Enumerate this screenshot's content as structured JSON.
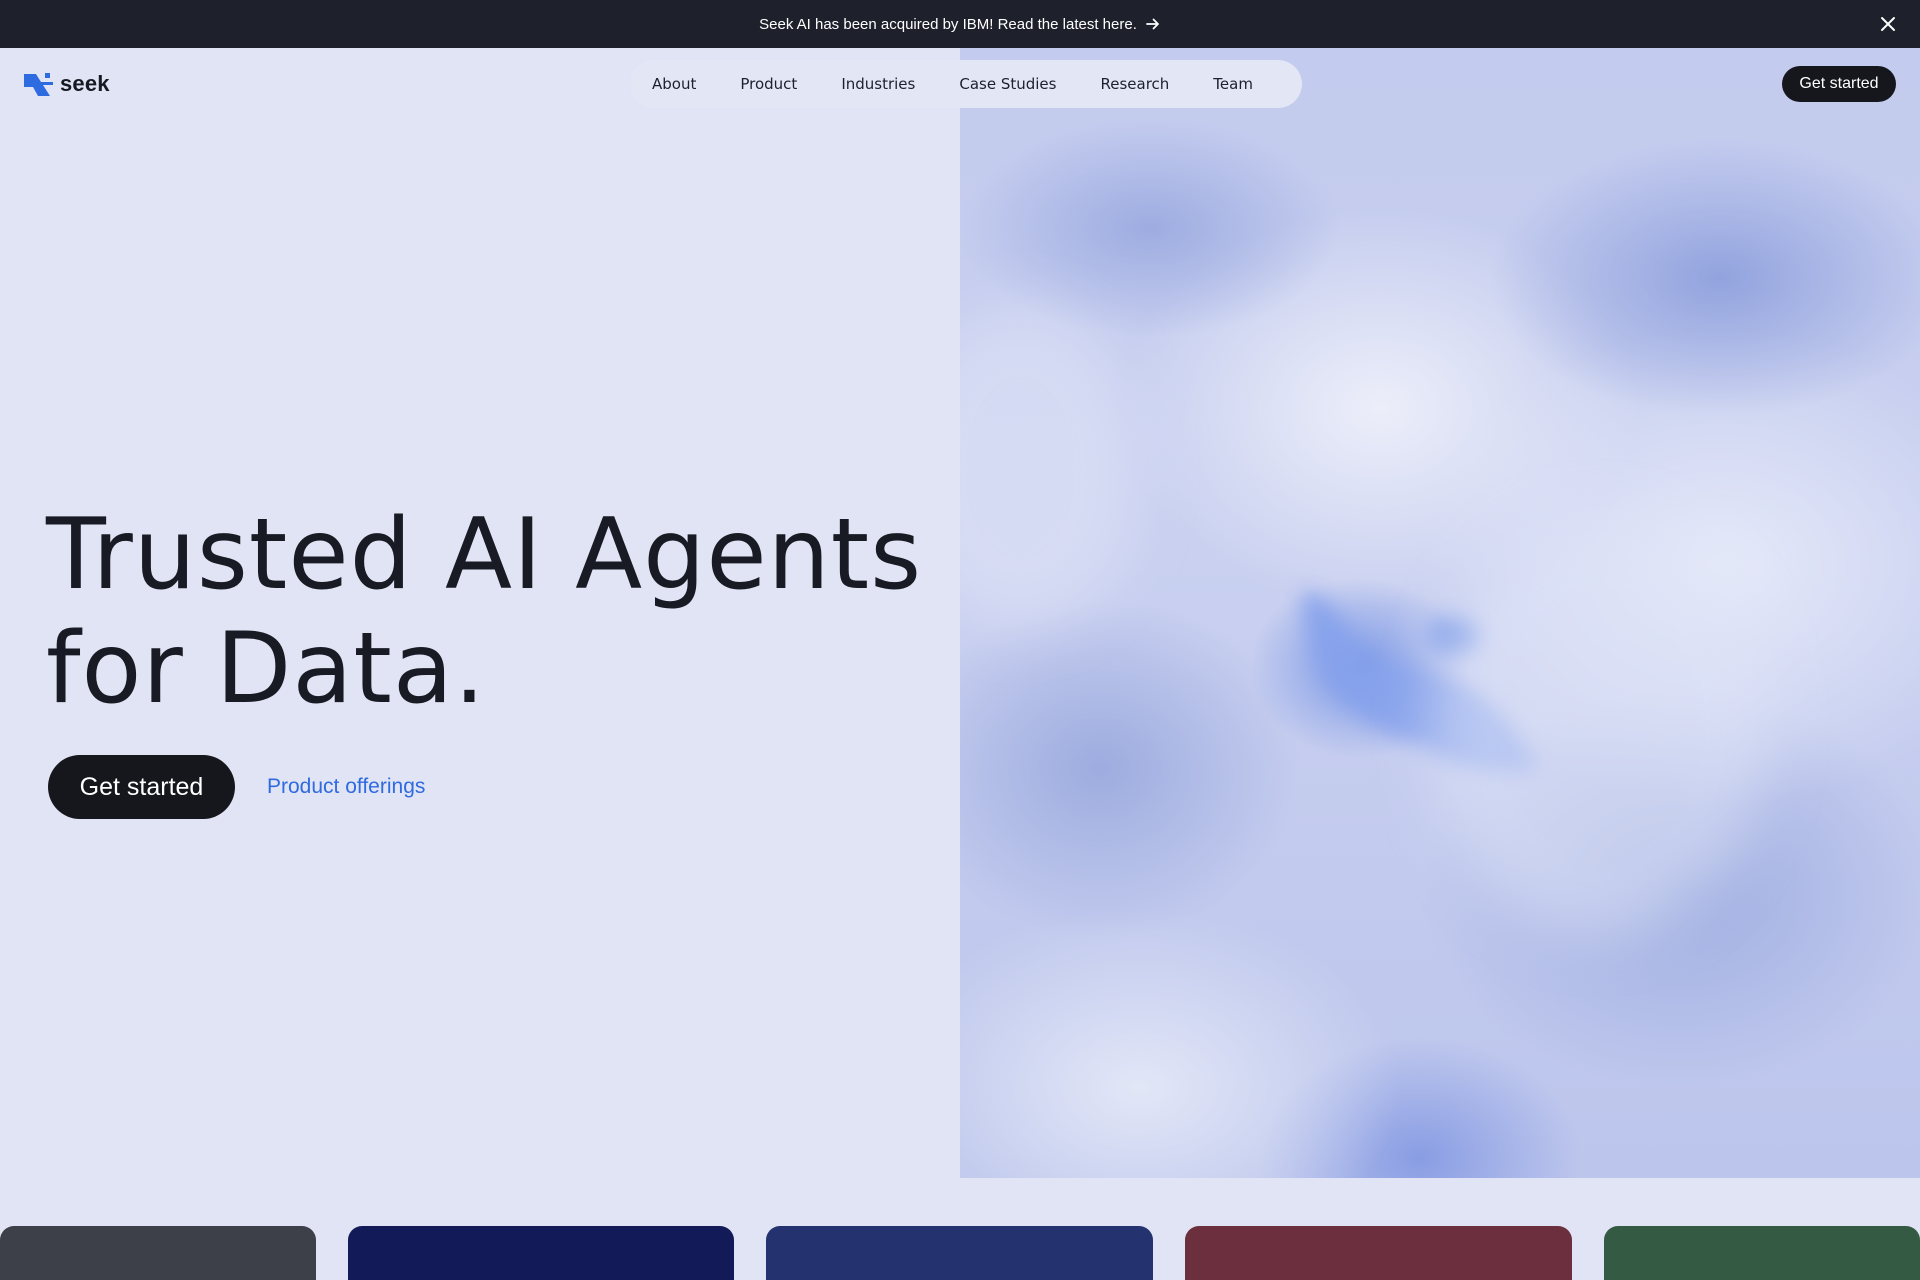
{
  "announcement": {
    "text": "Seek AI has been acquired by IBM! Read the latest here.",
    "arrow_icon": "arrow-right-icon",
    "close_icon": "close-icon"
  },
  "brand": {
    "name": "seek",
    "logo_color": "#2f6be0"
  },
  "nav": {
    "items": [
      {
        "label": "About"
      },
      {
        "label": "Product"
      },
      {
        "label": "Industries"
      },
      {
        "label": "Case Studies"
      },
      {
        "label": "Research"
      },
      {
        "label": "Team"
      }
    ]
  },
  "header": {
    "cta_label": "Get started"
  },
  "hero": {
    "title_line1": "Trusted AI Agents",
    "title_line2": "for Data.",
    "cta_label": "Get started",
    "secondary_link": "Product offerings"
  },
  "cards": [
    {
      "color": "#3d4049"
    },
    {
      "color": "#121b58"
    },
    {
      "color": "#24336f"
    },
    {
      "color": "#6b2f3d"
    },
    {
      "color": "#355a44"
    }
  ]
}
